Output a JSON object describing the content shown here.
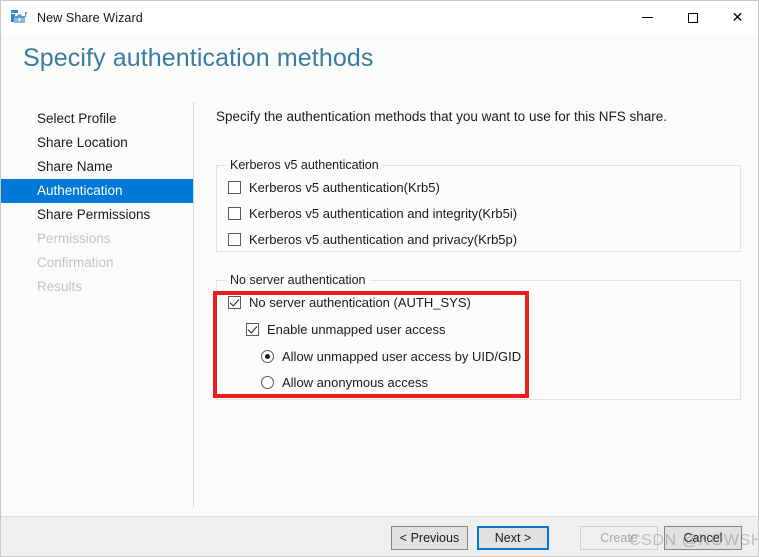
{
  "window": {
    "title": "New Share Wizard",
    "icon": "share-wizard-icon",
    "controls": {
      "minimize": "minimize-icon",
      "maximize": "maximize-icon",
      "close": "close-icon"
    }
  },
  "header": {
    "title": "Specify authentication methods",
    "accent_color": "#3a7ca0"
  },
  "sidebar": {
    "items": [
      {
        "label": "Select Profile",
        "state": "completed"
      },
      {
        "label": "Share Location",
        "state": "completed"
      },
      {
        "label": "Share Name",
        "state": "completed"
      },
      {
        "label": "Authentication",
        "state": "selected"
      },
      {
        "label": "Share Permissions",
        "state": "completed"
      },
      {
        "label": "Permissions",
        "state": "disabled"
      },
      {
        "label": "Confirmation",
        "state": "disabled"
      },
      {
        "label": "Results",
        "state": "disabled"
      }
    ],
    "selected_color": "#0078d7",
    "disabled_color": "#c4c4c4"
  },
  "main": {
    "intro": "Specify the authentication methods that you want to use for this NFS share.",
    "kerberos_group": {
      "legend": "Kerberos v5 authentication",
      "options": [
        {
          "label": "Kerberos v5 authentication(Krb5)",
          "type": "checkbox",
          "checked": false
        },
        {
          "label": "Kerberos v5 authentication and integrity(Krb5i)",
          "type": "checkbox",
          "checked": false
        },
        {
          "label": "Kerberos v5 authentication and privacy(Krb5p)",
          "type": "checkbox",
          "checked": false
        }
      ]
    },
    "noserver_group": {
      "legend": "No server authentication",
      "options": [
        {
          "label": "No server authentication (AUTH_SYS)",
          "type": "checkbox",
          "checked": true,
          "indent": 0
        },
        {
          "label": "Enable unmapped user access",
          "type": "checkbox",
          "checked": true,
          "indent": 1
        },
        {
          "label": "Allow unmapped user access by UID/GID",
          "type": "radio",
          "checked": true,
          "indent": 2
        },
        {
          "label": "Allow anonymous access",
          "type": "radio",
          "checked": false,
          "indent": 2
        }
      ]
    }
  },
  "annotation": {
    "highlight_color": "#ef1c1c"
  },
  "footer": {
    "buttons": [
      {
        "id": "previous",
        "label": "< Previous",
        "state": "enabled"
      },
      {
        "id": "next",
        "label": "Next >",
        "state": "default"
      },
      {
        "id": "create",
        "label": "Create",
        "state": "disabled"
      },
      {
        "id": "cancel",
        "label": "Cancel",
        "state": "enabled"
      }
    ]
  },
  "watermark": {
    "text": "CSDN @NOWSHUT"
  }
}
